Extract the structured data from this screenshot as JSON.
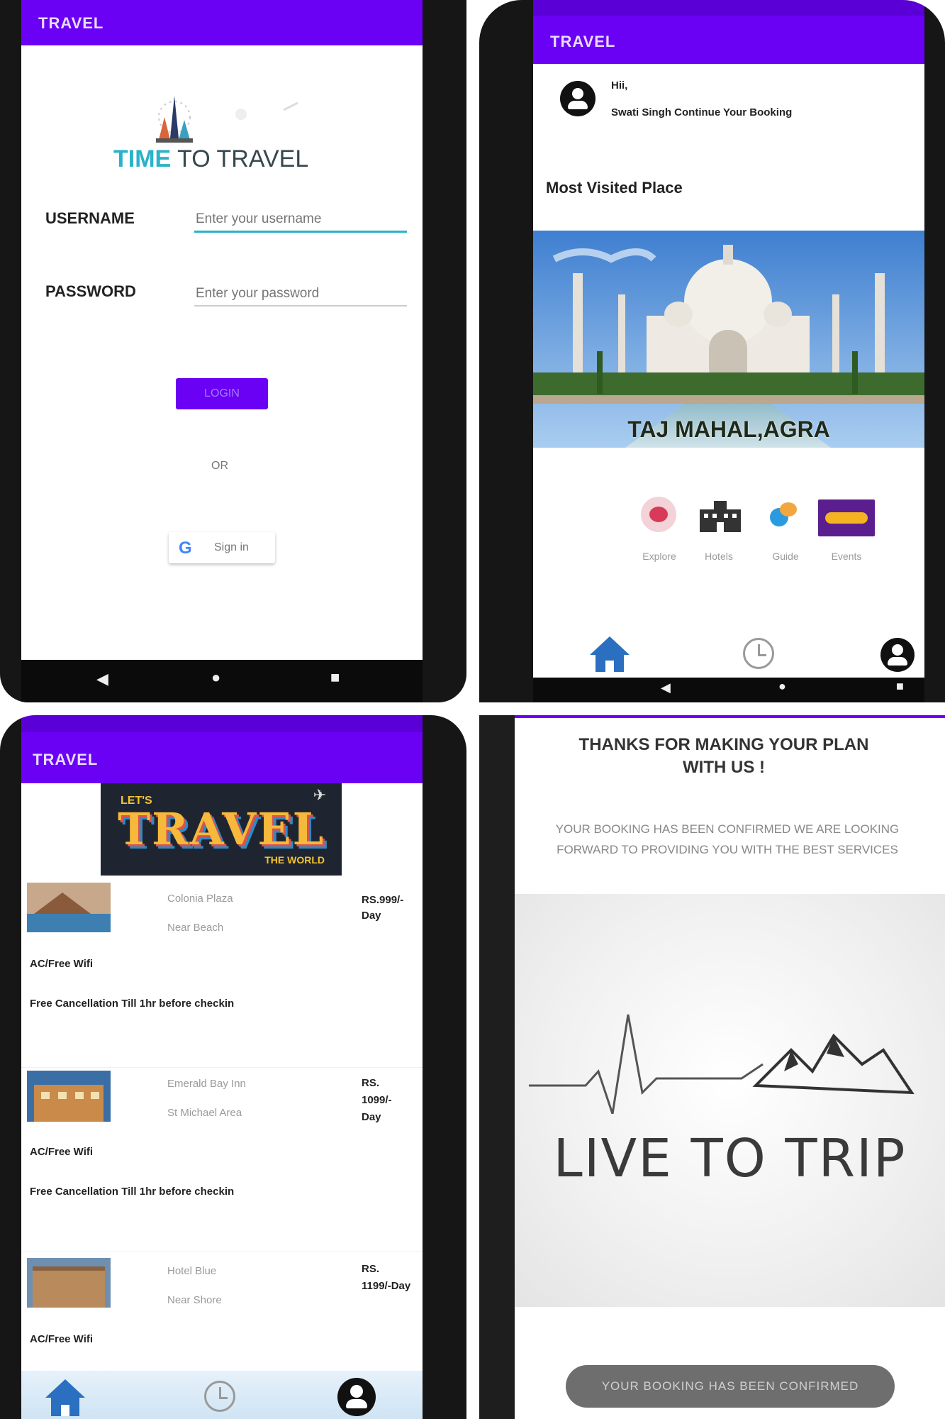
{
  "colors": {
    "primary": "#6a00f4",
    "accent_teal": "#2ab3c8",
    "nav_blue": "#2a6fc0"
  },
  "login": {
    "app_title": "TRAVEL",
    "logo_word_1": "TIME",
    "logo_word_2": "TO TRAVEL",
    "username_label": "USERNAME",
    "username_placeholder": "Enter your username",
    "password_label": "PASSWORD",
    "password_placeholder": "Enter your password",
    "login_button": "LOGIN",
    "or_text": "OR",
    "google_sign_in": "Sign in"
  },
  "home": {
    "app_title": "TRAVEL",
    "greeting": "Hii,",
    "greeting_sub": "Swati Singh Continue Your Booking",
    "section_title": "Most Visited Place",
    "featured_caption": "TAJ MAHAL,AGRA",
    "categories": [
      {
        "label": "Explore",
        "icon": "explore-icon"
      },
      {
        "label": "Hotels",
        "icon": "hotel-icon"
      },
      {
        "label": "Guide",
        "icon": "guide-icon"
      },
      {
        "label": "Events",
        "icon": "events-icon"
      }
    ]
  },
  "hotels": {
    "app_title": "TRAVEL",
    "banner_small": "LET'S",
    "banner_main": "TRAVEL",
    "banner_sub": "THE WORLD",
    "items": [
      {
        "name": "Colonia Plaza",
        "location": "Near Beach",
        "price": "RS.999/-Day",
        "amenities": "AC/Free Wifi",
        "policy": "Free Cancellation Till 1hr before checkin"
      },
      {
        "name": "Emerald Bay Inn",
        "location": "St Michael Area",
        "price": "RS. 1099/-Day",
        "amenities": "AC/Free Wifi",
        "policy": "Free Cancellation Till 1hr before checkin"
      },
      {
        "name": "Hotel Blue",
        "location": "Near Shore",
        "price": "RS. 1199/-Day",
        "amenities": "AC/Free Wifi",
        "policy": ""
      }
    ]
  },
  "confirm": {
    "heading": "THANKS FOR MAKING YOUR PLAN WITH US !",
    "message": "YOUR BOOKING HAS BEEN CONFIRMED WE ARE LOOKING FORWARD TO PROVIDING YOU WITH THE BEST SERVICES",
    "logo_text": "LIVE TO TRIP",
    "toast": "YOUR BOOKING HAS BEEN CONFIRMED"
  }
}
